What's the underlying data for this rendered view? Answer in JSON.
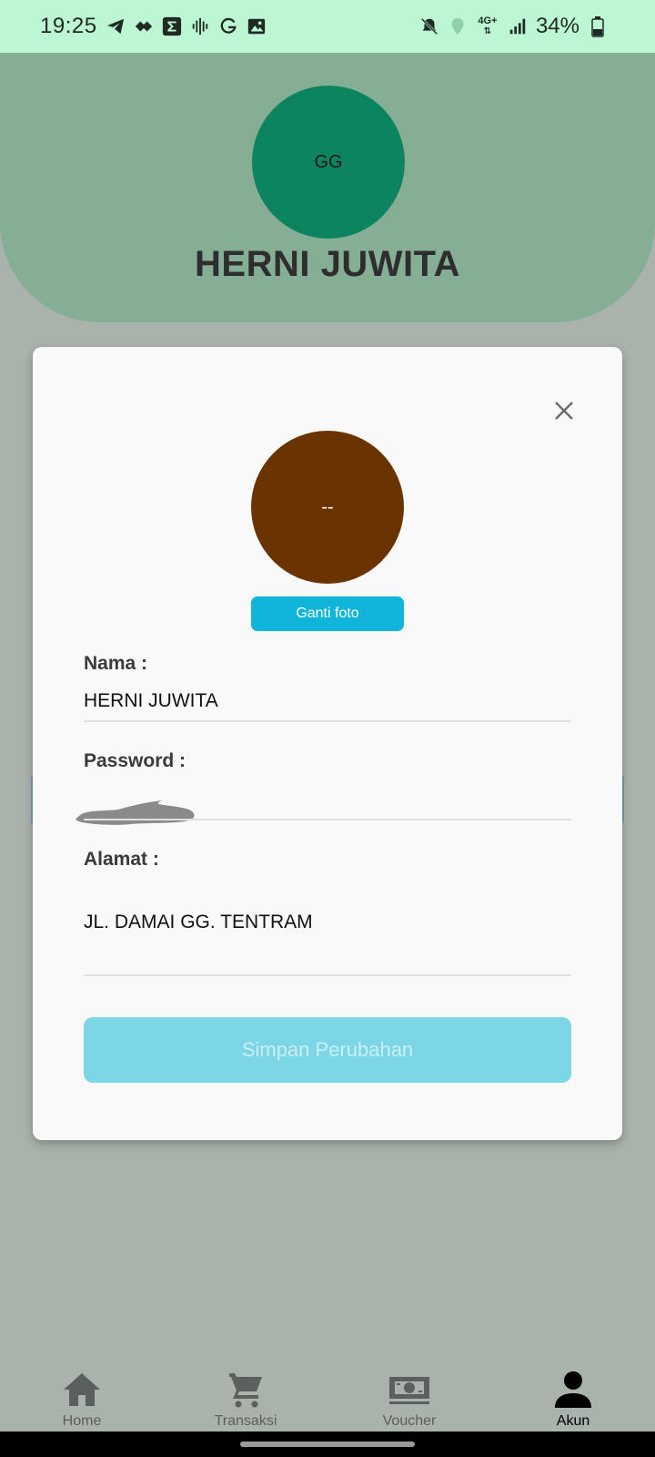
{
  "status_bar": {
    "time": "19:25",
    "battery": "34%",
    "left_icons": [
      "telegram-icon",
      "diamond-icon",
      "sigma-icon",
      "voice-icon",
      "grammarly-icon",
      "gallery-icon"
    ],
    "right_icons": [
      "mute-icon",
      "location-icon",
      "network-4g-icon",
      "signal-icon",
      "battery-icon"
    ],
    "network_label": "4G+"
  },
  "header": {
    "avatar_initials": "GG",
    "name": "HERNI JUWITA"
  },
  "modal": {
    "avatar_text": "--",
    "change_photo_label": "Ganti foto",
    "fields": {
      "name_label": "Nama :",
      "name_value": "HERNI JUWITA",
      "password_label": "Password :",
      "address_label": "Alamat :",
      "address_value": "JL. DAMAI GG. TENTRAM"
    },
    "save_label": "Simpan Perubahan"
  },
  "bottom_nav": {
    "items": [
      {
        "label": "Home",
        "icon": "home-icon"
      },
      {
        "label": "Transaksi",
        "icon": "cart-icon"
      },
      {
        "label": "Voucher",
        "icon": "money-icon"
      },
      {
        "label": "Akun",
        "icon": "user-icon",
        "active": true
      }
    ]
  },
  "colors": {
    "status_bar_bg": "#bcf6d3",
    "header_bg": "#86ae94",
    "header_avatar": "#0c8460",
    "modal_avatar": "#6b3300",
    "accent": "#0fb6d9",
    "save_button_disabled": "#7dd6e6",
    "backdrop": "#a9b2ab"
  }
}
